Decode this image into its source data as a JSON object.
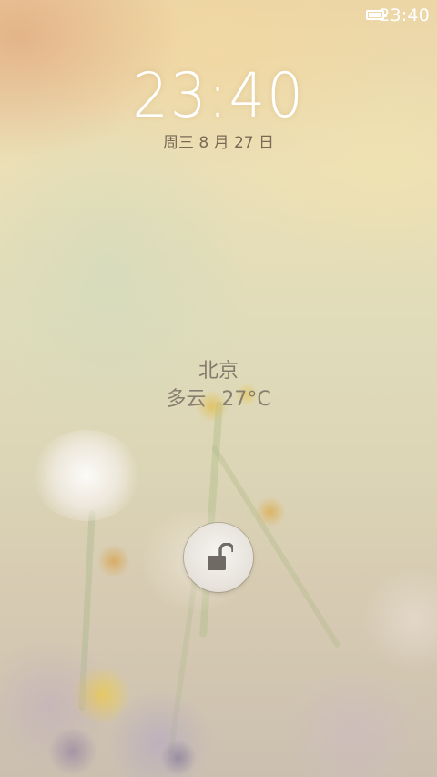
{
  "status_bar": {
    "time": "23:40",
    "battery_icon": "battery-icon"
  },
  "clock": {
    "time": "23:40",
    "date": "周三 8 月 27 日"
  },
  "weather": {
    "city": "北京",
    "condition": "多云",
    "temperature": "27°C"
  },
  "unlock": {
    "icon": "unlocked-padlock-icon"
  },
  "colors": {
    "clock_text": "#ffffff",
    "info_text": "#857a6c",
    "background_top": "#ecd6a6",
    "background_bottom": "#cbc0b0"
  }
}
